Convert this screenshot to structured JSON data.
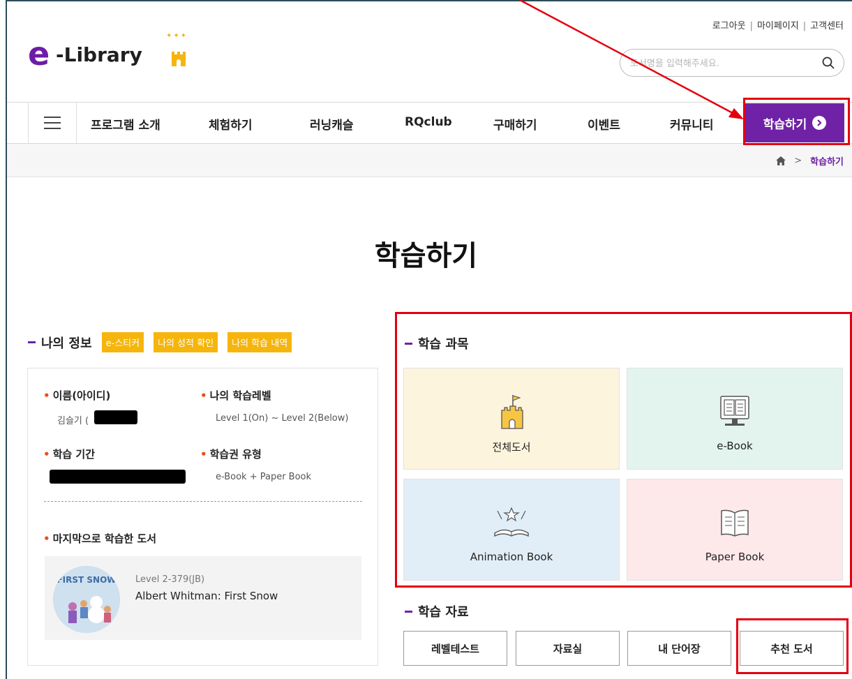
{
  "header": {
    "logo_e": "e",
    "logo_text": "-Library",
    "top_links": [
      "로그아웃",
      "마이페이지",
      "고객센터"
    ],
    "search_placeholder": "도서명을 입력해주세요."
  },
  "nav": {
    "items": [
      "프로그램 소개",
      "체험하기",
      "러닝캐슬",
      "RQclub",
      "구매하기",
      "이벤트",
      "커뮤니티"
    ],
    "active_label": "학습하기",
    "active_color": "#6f22a6"
  },
  "breadcrumb": {
    "current": "학습하기"
  },
  "page_title": "학습하기",
  "my_info": {
    "heading": "나의 정보",
    "tags": [
      "e-스티커",
      "나의 성적 확인",
      "나의 학습 내역"
    ],
    "name_label": "이름(아이디)",
    "name_value": "김슬기 (",
    "level_label": "나의 학습레벨",
    "level_value": "Level 1(On) ~ Level 2(Below)",
    "period_label": "학습 기간",
    "pass_label": "학습권 유형",
    "pass_value": "e-Book + Paper Book",
    "last_book_label": "마지막으로 학습한 도서",
    "last_book": {
      "level": "Level 2-379(JB)",
      "title": "Albert Whitman: First Snow",
      "cover_text": "FIRST SNOW"
    }
  },
  "subjects": {
    "heading": "학습 과목",
    "items": [
      {
        "label": "전체도서",
        "icon": "castle-icon",
        "bg": "#fdf4de"
      },
      {
        "label": "e-Book",
        "icon": "monitor-book-icon",
        "bg": "#e3f4ee"
      },
      {
        "label": "Animation Book",
        "icon": "animation-book-icon",
        "bg": "#e1eef8"
      },
      {
        "label": "Paper Book",
        "icon": "paper-book-icon",
        "bg": "#fde8ea"
      }
    ]
  },
  "materials": {
    "heading": "학습 자료",
    "buttons": [
      "레벨테스트",
      "자료실",
      "내 단어장",
      "추천 도서"
    ]
  }
}
